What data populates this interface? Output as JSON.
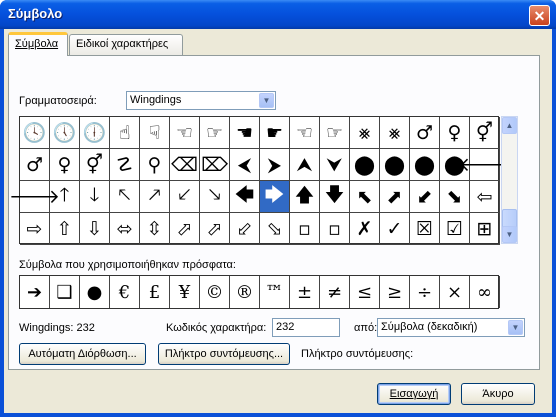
{
  "window": {
    "title": "Σύμβολο",
    "close_icon": "close-icon"
  },
  "tabs": [
    {
      "label": "Σύμβολα",
      "active": true
    },
    {
      "label": "Ειδικοί χαρακτήρες",
      "active": false
    }
  ],
  "font": {
    "label": "Γραμματοσειρά:",
    "value": "Wingdings"
  },
  "symbols_grid": {
    "rows": [
      [
        "🕓",
        "🕔",
        "🕕",
        "☝",
        "☟",
        "☜",
        "☞",
        "☚",
        "☛",
        "☜",
        "☞",
        "⨳",
        "⨳",
        "♂",
        "♀",
        "⚥"
      ],
      [
        "♂",
        "♀",
        "⚥",
        "☡",
        "⚲",
        "⌫",
        "⌦",
        "⮜",
        "⮞",
        "⮝",
        "⮟",
        "⬤",
        "⬤",
        "⬤",
        "⬤",
        "🡐"
      ],
      [
        "🡒",
        "🡑",
        "🡓",
        "🡔",
        "🡕",
        "🡗",
        "🡖",
        "🡄",
        "🡆",
        "🡅",
        "🡇",
        "⬉",
        "⬈",
        "⬋",
        "⬊",
        "⇦"
      ],
      [
        "⇨",
        "⇧",
        "⇩",
        "⬄",
        "⇳",
        "⬀",
        "⬀",
        "⬃",
        "⬂",
        "▫",
        "▫",
        "✗",
        "✓",
        "☒",
        "☑",
        "⊞"
      ]
    ],
    "selected": {
      "row": 2,
      "col": 8
    }
  },
  "recent": {
    "label": "Σύμβολα που χρησιμοποιήθηκαν πρόσφατα:",
    "symbols": [
      "➔",
      "❑",
      "●",
      "€",
      "£",
      "¥",
      "©",
      "®",
      "™",
      "±",
      "≠",
      "≤",
      "≥",
      "÷",
      "×",
      "∞"
    ]
  },
  "char_info": {
    "name": "Wingdings: 232",
    "code_label": "Κωδικός χαρακτήρα:",
    "code_value": "232",
    "from_label": "από:",
    "from_value": "Σύμβολα (δεκαδική)"
  },
  "buttons": {
    "autocorrect": "Αυτόματη Διόρθωση...",
    "shortcut_key": "Πλήκτρο συντόμευσης...",
    "insert": "Εισαγωγή",
    "cancel": "Άκυρο"
  },
  "shortcut_label": "Πλήκτρο συντόμευσης:",
  "colors": {
    "titlebar": "#0550dc",
    "selection": "#316ac5",
    "tab_highlight": "#ffc73c"
  }
}
